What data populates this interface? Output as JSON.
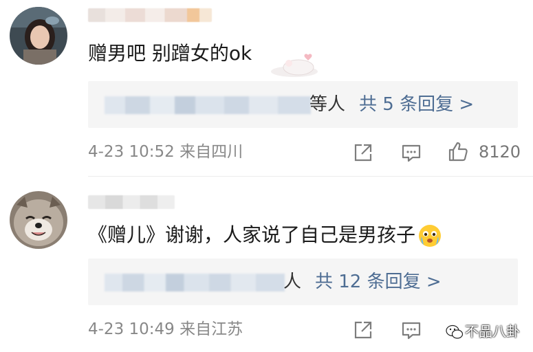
{
  "comments": [
    {
      "text": "赠男吧 别蹭女的ok",
      "reply_suffix": "等人",
      "reply_link": "共 5 条回复 >",
      "timestamp": "4-23 10:52",
      "source": "来自四川",
      "likes": "8120"
    },
    {
      "text": "《赠儿》谢谢，人家说了自己是男孩子",
      "emoji": "crying-face-emoji",
      "reply_suffix": "人",
      "reply_link": "共 12 条回复 >",
      "timestamp": "4-23 10:49",
      "source": "来自江苏"
    }
  ],
  "watermark": {
    "text": "不品八卦"
  },
  "colors": {
    "link": "#4e6d93",
    "meta": "#888888",
    "reply_bg": "#f5f5f5"
  },
  "icons": [
    "share-icon",
    "comment-icon",
    "thumbs-up-icon",
    "wechat-logo"
  ]
}
